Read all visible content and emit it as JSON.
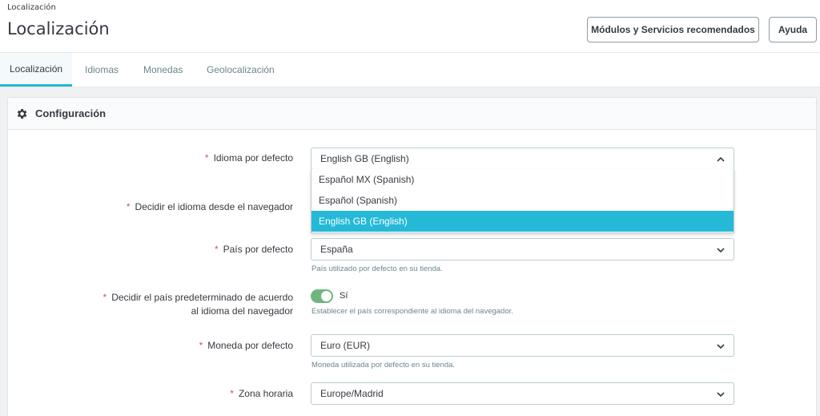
{
  "header": {
    "breadcrumb": "Localización",
    "title": "Localización",
    "modules_button": "Módulos y Servicios recomendados",
    "help_button": "Ayuda"
  },
  "tabs": [
    {
      "label": "Localización",
      "active": true
    },
    {
      "label": "Idiomas",
      "active": false
    },
    {
      "label": "Monedas",
      "active": false
    },
    {
      "label": "Geolocalización",
      "active": false
    }
  ],
  "panel": {
    "title": "Configuración",
    "icon": "gear-icon"
  },
  "form": {
    "required_mark": "*",
    "default_language": {
      "label": "Idioma por defecto",
      "value": "English GB (English)",
      "options": [
        "Español MX (Spanish)",
        "Español (Spanish)",
        "English GB (English)"
      ],
      "open": true
    },
    "browser_language": {
      "label": "Decidir el idioma desde el navegador"
    },
    "default_country": {
      "label": "País por defecto",
      "value": "España",
      "help": "País utilizado por defecto en su tienda."
    },
    "country_by_browser": {
      "label_line1": "Decidir el país predeterminado de acuerdo",
      "label_line2": "al idioma del navegador",
      "switch_label": "Sí",
      "enabled": true,
      "help": "Establecer el país correspondiente al idioma del navegador."
    },
    "default_currency": {
      "label": "Moneda por defecto",
      "value": "Euro (EUR)",
      "help": "Moneda utilizada por defecto en su tienda."
    },
    "timezone": {
      "label": "Zona horaria",
      "value": "Europe/Madrid"
    }
  },
  "colors": {
    "accent": "#25b9d7",
    "switch_on": "#70b580",
    "required": "#c05c67"
  }
}
